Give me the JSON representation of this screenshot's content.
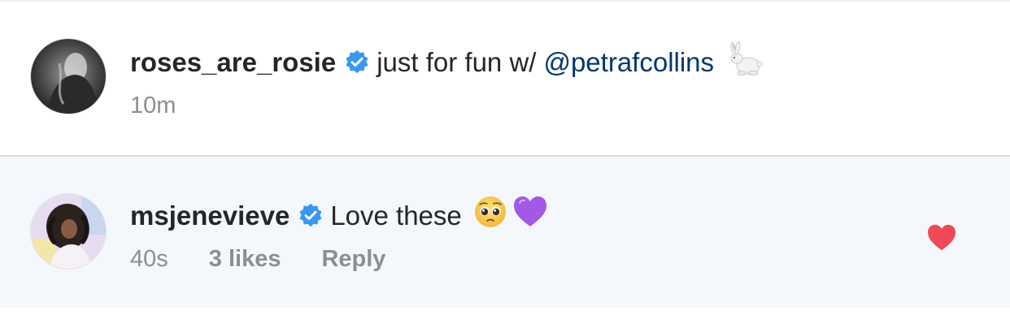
{
  "caption": {
    "username": "roses_are_rosie",
    "text": "just for fun w/",
    "mention": "@petrafcollins",
    "emoji": "rabbit-emoji",
    "time": "10m",
    "verified_icon": "verified-badge-icon"
  },
  "comment": {
    "username": "msjenevieve",
    "text": "Love these",
    "emojis": [
      "pleading-face-emoji",
      "purple-heart-emoji"
    ],
    "time": "40s",
    "likes": "3 likes",
    "reply": "Reply",
    "liked": true,
    "like_icon": "heart-icon"
  },
  "colors": {
    "verified": "#3897f0",
    "mention": "#00376b",
    "meta": "#8e8e8e",
    "liked_heart": "#ed4956",
    "comment_background": "#f4f8fc",
    "purple_heart": "#a259e6"
  }
}
